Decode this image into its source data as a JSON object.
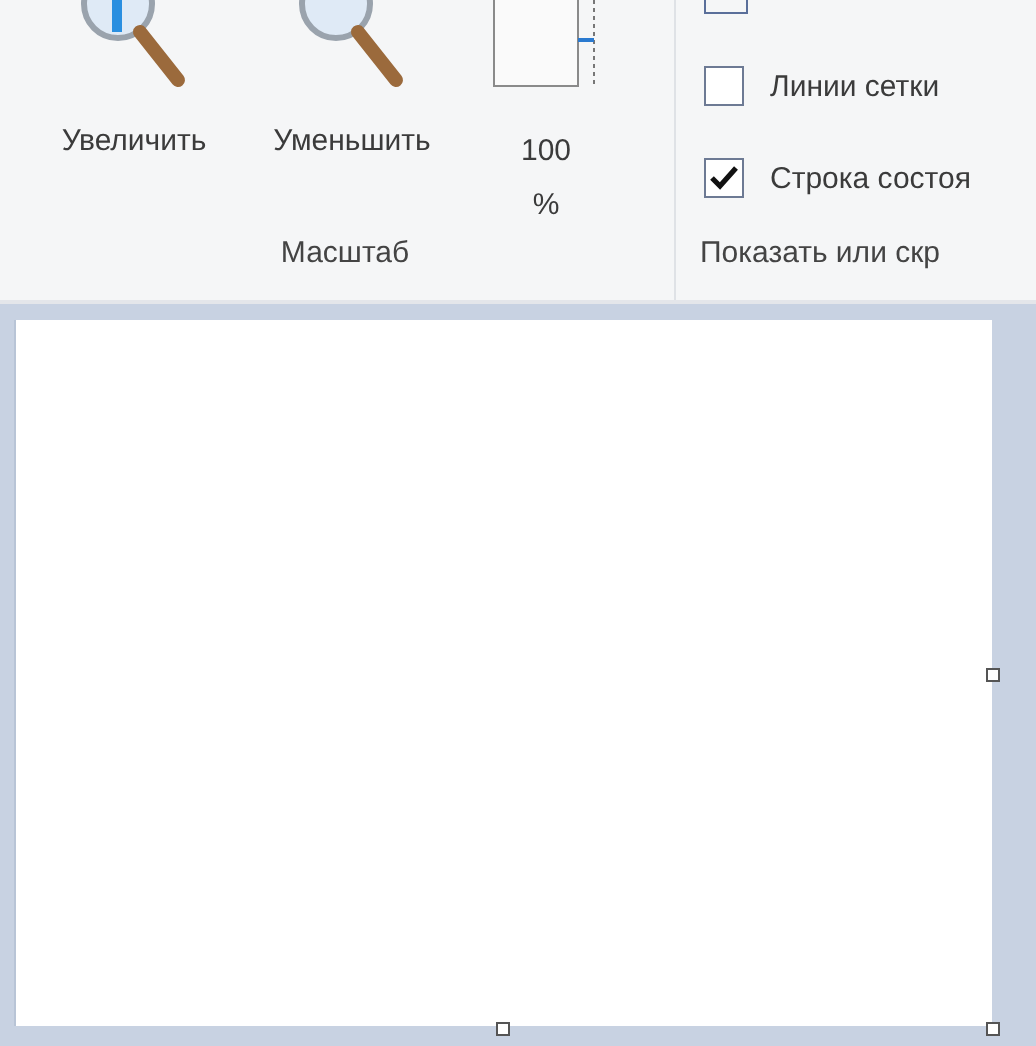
{
  "ribbon": {
    "groups": [
      {
        "kind": "zoom",
        "label": "Масштаб",
        "buttons": [
          {
            "kind": "zoom-in",
            "label": "Увеличить"
          },
          {
            "kind": "zoom-out",
            "label": "Уменьшить"
          },
          {
            "kind": "actual-size",
            "label": "100 %"
          }
        ]
      },
      {
        "kind": "show",
        "label": "Показать или скр",
        "checkboxes": [
          {
            "label": "Линии сетки",
            "checked": false
          },
          {
            "label": "Строка состоя",
            "checked": true
          }
        ]
      }
    ]
  }
}
